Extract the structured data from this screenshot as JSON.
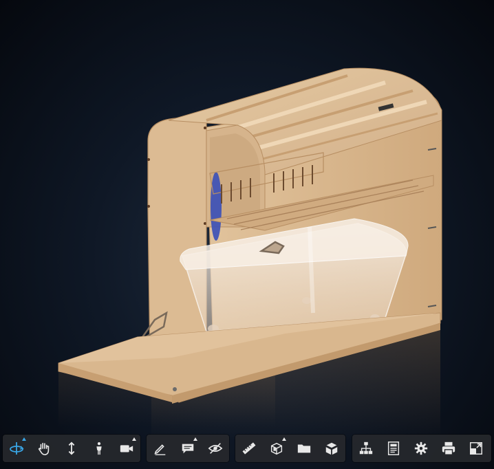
{
  "viewer": {
    "background_colors": [
      "#1d2a3c",
      "#05080e"
    ],
    "model_colors": {
      "wood": "#dcbb93",
      "wood_edge": "#c79f72",
      "bin": "#f1e6da",
      "accent": "#3a4fb8"
    }
  },
  "toolbar": {
    "accent": "#39a6e6",
    "icon_color": "#e8e8e8",
    "groups": [
      {
        "name": "navigation",
        "tools": [
          {
            "icon": "orbit-icon",
            "active": true,
            "flyout": true
          },
          {
            "icon": "pan-icon",
            "active": false,
            "flyout": false
          },
          {
            "icon": "dolly-icon",
            "active": false,
            "flyout": false
          },
          {
            "icon": "first-person-icon",
            "active": false,
            "flyout": false
          },
          {
            "icon": "camera-icon",
            "active": false,
            "flyout": true
          }
        ]
      },
      {
        "name": "review",
        "tools": [
          {
            "icon": "markup-pen-icon",
            "active": false,
            "flyout": false
          },
          {
            "icon": "comment-icon",
            "active": false,
            "flyout": true
          },
          {
            "icon": "hide-eye-icon",
            "active": false,
            "flyout": false
          }
        ]
      },
      {
        "name": "model",
        "tools": [
          {
            "icon": "measure-ruler-icon",
            "active": false,
            "flyout": false
          },
          {
            "icon": "section-cube-icon",
            "active": false,
            "flyout": true
          },
          {
            "icon": "folder-icon",
            "active": false,
            "flyout": false
          },
          {
            "icon": "explode-cube-icon",
            "active": false,
            "flyout": false
          }
        ]
      },
      {
        "name": "settings",
        "tools": [
          {
            "icon": "model-browser-icon",
            "active": false,
            "flyout": false
          },
          {
            "icon": "properties-icon",
            "active": false,
            "flyout": false
          },
          {
            "icon": "settings-gear-icon",
            "active": false,
            "flyout": false
          },
          {
            "icon": "print-icon",
            "active": false,
            "flyout": false
          },
          {
            "icon": "fullscreen-icon",
            "active": false,
            "flyout": false
          }
        ]
      }
    ]
  }
}
